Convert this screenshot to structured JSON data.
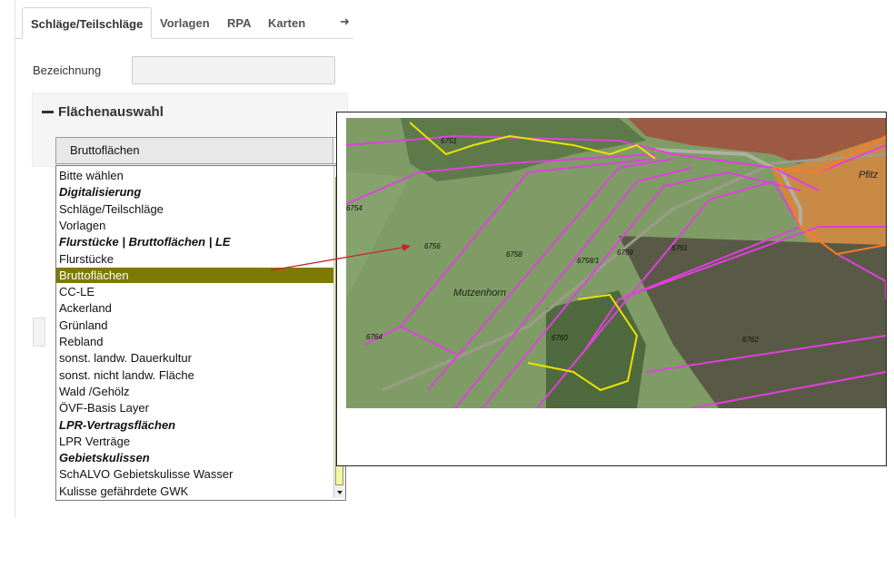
{
  "tabs": {
    "items": [
      {
        "label": "Schläge/Teilschläge",
        "active": true
      },
      {
        "label": "Vorlagen",
        "active": false
      },
      {
        "label": "RPA",
        "active": false
      },
      {
        "label": "Karten",
        "active": false
      }
    ],
    "more_icon": "➜"
  },
  "form": {
    "bezeichnung_label": "Bezeichnung",
    "bezeichnung_value": ""
  },
  "section": {
    "title": "Flächenauswahl",
    "collapse_icon": "minus-icon"
  },
  "select": {
    "value": "Bruttoflächen",
    "options": [
      {
        "label": "Bitte wählen",
        "group": false,
        "selected": false
      },
      {
        "label": "Digitalisierung",
        "group": true,
        "selected": false
      },
      {
        "label": "Schläge/Teilschläge",
        "group": false,
        "selected": false
      },
      {
        "label": "Vorlagen",
        "group": false,
        "selected": false
      },
      {
        "label": "Flurstücke | Bruttoflächen | LE",
        "group": true,
        "selected": false
      },
      {
        "label": "Flurstücke",
        "group": false,
        "selected": false
      },
      {
        "label": "Bruttoflächen",
        "group": false,
        "selected": true
      },
      {
        "label": "CC-LE",
        "group": false,
        "selected": false
      },
      {
        "label": "Ackerland",
        "group": false,
        "selected": false
      },
      {
        "label": "Grünland",
        "group": false,
        "selected": false
      },
      {
        "label": "Rebland",
        "group": false,
        "selected": false
      },
      {
        "label": "sonst. landw. Dauerkultur",
        "group": false,
        "selected": false
      },
      {
        "label": "sonst. nicht landw. Fläche",
        "group": false,
        "selected": false
      },
      {
        "label": "Wald /Gehölz",
        "group": false,
        "selected": false
      },
      {
        "label": "ÖVF-Basis Layer",
        "group": false,
        "selected": false
      },
      {
        "label": "LPR-Vertragsflächen",
        "group": true,
        "selected": false
      },
      {
        "label": "LPR Verträge",
        "group": false,
        "selected": false
      },
      {
        "label": "Gebietskulissen",
        "group": true,
        "selected": false
      },
      {
        "label": "SchALVO Gebietskulisse Wasser",
        "group": false,
        "selected": false
      },
      {
        "label": "Kulisse gefährdete GWK",
        "group": false,
        "selected": false
      }
    ]
  },
  "map": {
    "place_name": "Mutzenhorn",
    "edge_text": "Pfitz",
    "parcel_labels": [
      "6756",
      "6758",
      "6758/1",
      "6759",
      "6761",
      "6760",
      "6762",
      "6754",
      "6764",
      "6751"
    ],
    "colors": {
      "parcel_outline": "#e040e0",
      "field_green": "#7fa468",
      "highlight_yellow": "#e8e400",
      "selection": "#7d7a00",
      "arrow": "#cc2222"
    }
  }
}
